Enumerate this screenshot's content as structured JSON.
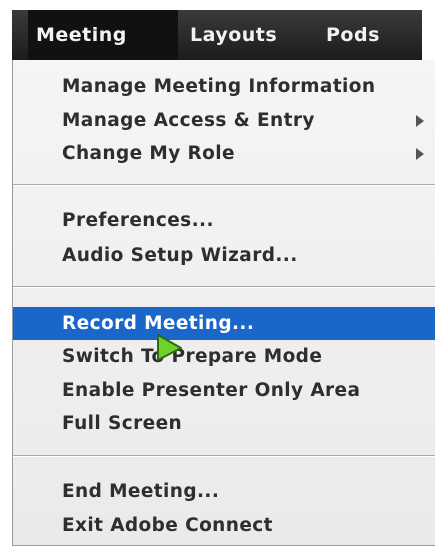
{
  "menubar": {
    "items": [
      {
        "label": "Meeting",
        "active": true
      },
      {
        "label": "Layouts",
        "active": false
      },
      {
        "label": "Pods",
        "active": false
      }
    ]
  },
  "dropdown": {
    "groups": [
      [
        {
          "label": "Manage Meeting Information",
          "submenu": false
        },
        {
          "label": "Manage Access & Entry",
          "submenu": true
        },
        {
          "label": "Change My Role",
          "submenu": true
        }
      ],
      [
        {
          "label": "Preferences...",
          "submenu": false
        },
        {
          "label": "Audio Setup Wizard...",
          "submenu": false
        }
      ],
      [
        {
          "label": "Record Meeting...",
          "submenu": false,
          "highlighted": true
        },
        {
          "label": "Switch To Prepare Mode",
          "submenu": false
        },
        {
          "label": "Enable Presenter Only Area",
          "submenu": false
        },
        {
          "label": "Full Screen",
          "submenu": false
        }
      ],
      [
        {
          "label": "End Meeting...",
          "submenu": false
        },
        {
          "label": "Exit Adobe Connect",
          "submenu": false
        }
      ]
    ]
  },
  "colors": {
    "highlight": "#1a66c9",
    "menubar": "#262626",
    "cursor": "#6fd12b"
  },
  "icons": {
    "cursor": "pointer-cursor-icon",
    "submenu": "chevron-right-icon"
  }
}
